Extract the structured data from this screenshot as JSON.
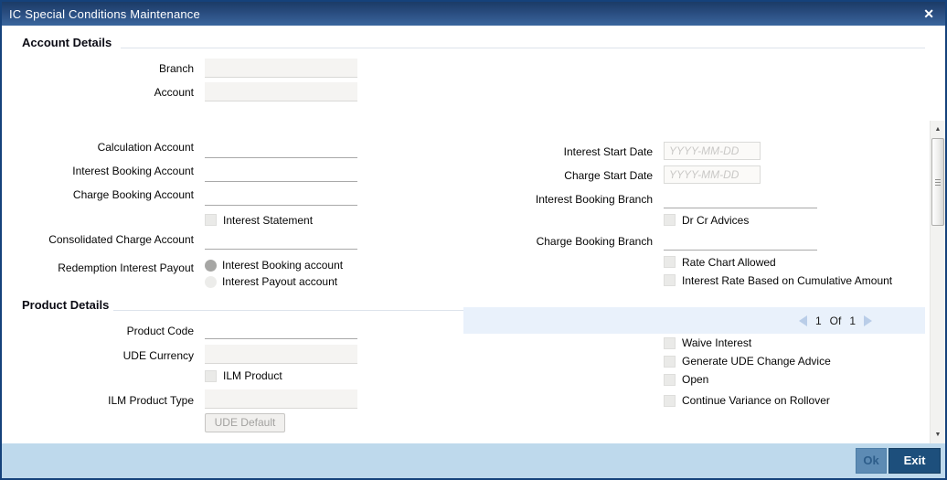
{
  "window": {
    "title": "IC Special Conditions Maintenance",
    "close_glyph": "✕"
  },
  "sections": {
    "account_details": "Account Details",
    "product_details": "Product Details"
  },
  "labels": {
    "branch": "Branch",
    "account": "Account",
    "calculation_account": "Calculation Account",
    "interest_booking_account": "Interest Booking Account",
    "charge_booking_account": "Charge Booking Account",
    "interest_statement": "Interest Statement",
    "consolidated_charge_account": "Consolidated Charge Account",
    "redemption_interest_payout": "Redemption Interest Payout",
    "radio_interest_booking_account": "Interest Booking account",
    "radio_interest_payout_account": "Interest Payout account",
    "interest_start_date": "Interest Start Date",
    "charge_start_date": "Charge Start Date",
    "date_placeholder": "YYYY-MM-DD",
    "interest_booking_branch": "Interest Booking Branch",
    "dr_cr_advices": "Dr Cr Advices",
    "charge_booking_branch": "Charge Booking Branch",
    "rate_chart_allowed": "Rate Chart Allowed",
    "interest_rate_cumulative": "Interest Rate Based on Cumulative Amount",
    "product_code": "Product Code",
    "ude_currency": "UDE Currency",
    "ilm_product": "ILM Product",
    "ilm_product_type": "ILM Product Type",
    "ude_default_button": "UDE Default",
    "waive_interest": "Waive Interest",
    "generate_ude_change_advice": "Generate UDE Change Advice",
    "open": "Open",
    "continue_variance_on_rollover": "Continue Variance on Rollover"
  },
  "state": {
    "redemption_interest_payout_selected": "Interest Booking account",
    "all_checkboxes_unchecked": true
  },
  "pagination": {
    "current_page": "1",
    "of_label": "Of",
    "total_pages": "1"
  },
  "scrollbar": {
    "up_glyph": "▲",
    "down_glyph": "▼"
  },
  "footer": {
    "ok_label": "Ok",
    "exit_label": "Exit"
  },
  "colors": {
    "window_border": "#15427b",
    "title_bar": "#294c7f",
    "pagination_bg": "#e9f1fb",
    "footer_bg": "#bed9ec",
    "ok_button_bg": "#5d8bb4",
    "exit_button_bg": "#1d4f7c",
    "disabled_field_bg": "#f5f4f2"
  }
}
